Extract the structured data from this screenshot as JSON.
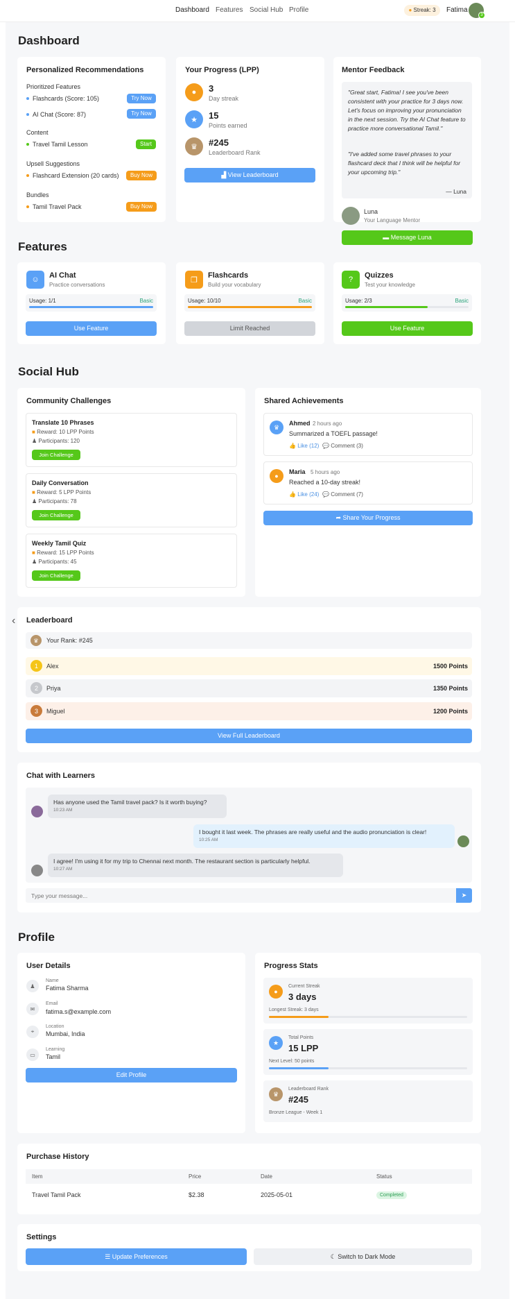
{
  "nav": {
    "links": [
      "Dashboard",
      "Features",
      "Social Hub",
      "Profile"
    ],
    "streak": "Streak: 3",
    "user": "Fatima",
    "badge": "3"
  },
  "dashboard": {
    "title": "Dashboard",
    "recommendations": {
      "title": "Personalized Recommendations",
      "groups": [
        {
          "heading": "Prioritized Features",
          "items": [
            {
              "label": "Flashcards (Score: 105)",
              "button": "Try Now"
            },
            {
              "label": "AI Chat (Score: 87)",
              "button": "Try Now"
            }
          ]
        },
        {
          "heading": "Content",
          "items": [
            {
              "label": "Travel Tamil Lesson",
              "button": "Start"
            }
          ]
        },
        {
          "heading": "Upsell Suggestions",
          "items": [
            {
              "label": "Flashcard Extension (20 cards)",
              "button": "Buy Now"
            }
          ]
        },
        {
          "heading": "Bundles",
          "items": [
            {
              "label": "Tamil Travel Pack",
              "button": "Buy Now"
            }
          ]
        }
      ]
    },
    "progress": {
      "title": "Your Progress (LPP)",
      "stats": [
        {
          "value": "3",
          "label": "Day streak"
        },
        {
          "value": "15",
          "label": "Points earned"
        },
        {
          "value": "#245",
          "label": "Leaderboard Rank"
        }
      ],
      "button": "View Leaderboard"
    },
    "mentor": {
      "title": "Mentor Feedback",
      "quote1": "\"Great start, Fatima! I see you've been consistent with your practice for 3 days now. Let's focus on improving your pronunciation in the next session. Try the AI Chat feature to practice more conversational Tamil.\"",
      "quote2": "\"I've added some travel phrases to your flashcard deck that I think will be helpful for your upcoming trip.\"",
      "signature": "— Luna",
      "name": "Luna",
      "role": "Your Language Mentor",
      "button": "Message Luna"
    }
  },
  "features": {
    "title": "Features",
    "cards": [
      {
        "name": "AI Chat",
        "desc": "Practice conversations",
        "usage": "Usage: 1/1",
        "tier": "Basic",
        "progress": 1.0,
        "button": "Use Feature"
      },
      {
        "name": "Flashcards",
        "desc": "Build your vocabulary",
        "usage": "Usage: 10/10",
        "tier": "Basic",
        "progress": 1.0,
        "button": "Limit Reached"
      },
      {
        "name": "Quizzes",
        "desc": "Test your knowledge",
        "usage": "Usage: 2/3",
        "tier": "Basic",
        "progress": 0.667,
        "button": "Use Feature"
      }
    ]
  },
  "social": {
    "title": "Social Hub",
    "challenges": {
      "title": "Community Challenges",
      "items": [
        {
          "name": "Translate 10 Phrases",
          "reward": "Reward: 10 LPP Points",
          "participants": "Participants: 120",
          "button": "Join Challenge"
        },
        {
          "name": "Daily Conversation",
          "reward": "Reward: 5 LPP Points",
          "participants": "Participants: 78",
          "button": "Join Challenge"
        },
        {
          "name": "Weekly Tamil Quiz",
          "reward": "Reward: 15 LPP Points",
          "participants": "Participants: 45",
          "button": "Join Challenge"
        }
      ]
    },
    "achievements": {
      "title": "Shared Achievements",
      "items": [
        {
          "name": "Ahmed",
          "time": "2 hours ago",
          "text": "Summarized a TOEFL passage!",
          "like": "Like (12)",
          "comment": "Comment (3)"
        },
        {
          "name": "Maria",
          "time": "5 hours ago",
          "text": "Reached a 10-day streak!",
          "like": "Like (24)",
          "comment": "Comment (7)"
        }
      ],
      "button": "Share Your Progress"
    },
    "leaderboard": {
      "title": "Leaderboard",
      "your_rank": "Your Rank: #245",
      "rows": [
        {
          "rank": "1",
          "name": "Alex",
          "points": "1500 Points"
        },
        {
          "rank": "2",
          "name": "Priya",
          "points": "1350 Points"
        },
        {
          "rank": "3",
          "name": "Miguel",
          "points": "1200 Points"
        }
      ],
      "button": "View Full Leaderboard"
    },
    "chat": {
      "title": "Chat with Learners",
      "messages": [
        {
          "text": "Has anyone used the Tamil travel pack? Is it worth buying?",
          "time": "10:23 AM"
        },
        {
          "text": "I bought it last week. The phrases are really useful and the audio pronunciation is clear!",
          "time": "10:25 AM"
        },
        {
          "text": "I agree! I'm using it for my trip to Chennai next month. The restaurant section is particularly helpful.",
          "time": "10:27 AM"
        }
      ],
      "placeholder": "Type your message..."
    }
  },
  "profile": {
    "title": "Profile",
    "details": {
      "title": "User Details",
      "fields": [
        {
          "label": "Name",
          "value": "Fatima Sharma"
        },
        {
          "label": "Email",
          "value": "fatima.s@example.com"
        },
        {
          "label": "Location",
          "value": "Mumbai, India"
        },
        {
          "label": "Learning",
          "value": "Tamil"
        }
      ],
      "button": "Edit Profile"
    },
    "stats": {
      "title": "Progress Stats",
      "streak": {
        "label": "Current Streak",
        "value": "3 days",
        "sub": "Longest Streak: 3 days",
        "progress": 0.3
      },
      "points": {
        "label": "Total Points",
        "value": "15 LPP",
        "sub": "Next Level: 50 points",
        "progress": 0.3
      },
      "rank": {
        "label": "Leaderboard Rank",
        "value": "#245",
        "sub": "Bronze League - Week 1"
      }
    },
    "purchases": {
      "title": "Purchase History",
      "columns": [
        "Item",
        "Price",
        "Date",
        "Status"
      ],
      "rows": [
        {
          "item": "Travel Tamil Pack",
          "price": "$2.38",
          "date": "2025-05-01",
          "status": "Completed"
        }
      ]
    },
    "settings": {
      "title": "Settings",
      "update": "Update Preferences",
      "dark": "Switch to Dark Mode"
    }
  },
  "colors": {
    "blue": "#5aa1f6",
    "green": "#55c81a",
    "orange": "#f59c1a",
    "gold": "#b8956a"
  }
}
